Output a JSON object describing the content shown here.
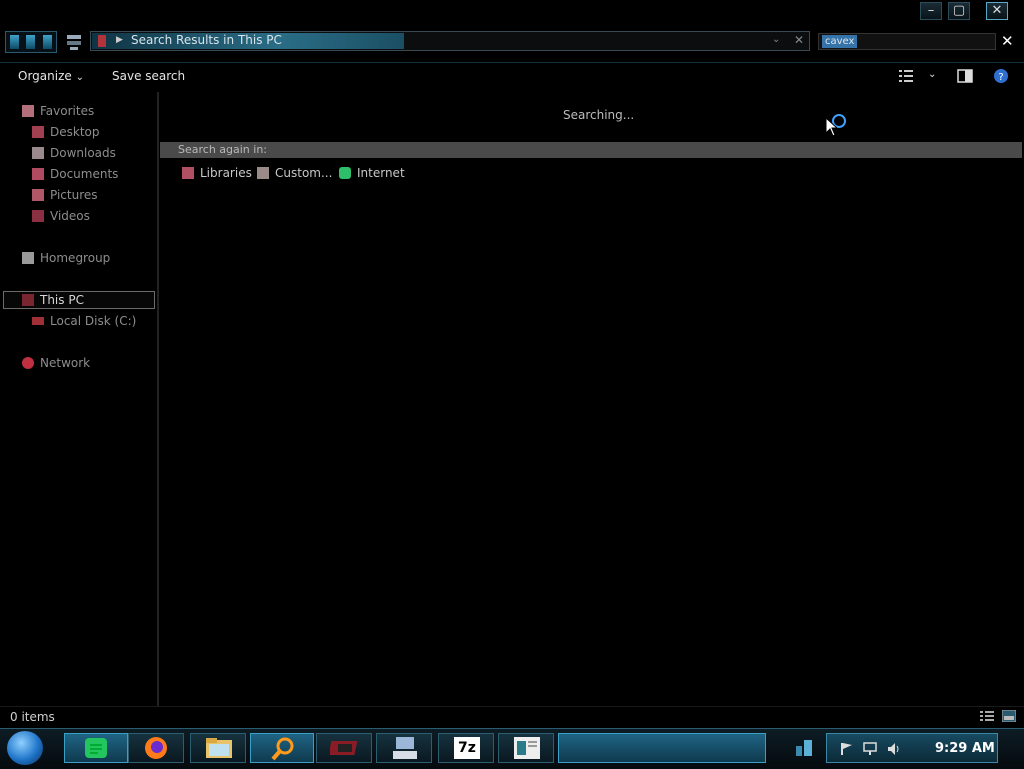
{
  "window": {
    "address": "Search Results in This PC",
    "search_query": "cavex"
  },
  "toolbar": {
    "organize_label": "Organize",
    "save_search_label": "Save search"
  },
  "nav": {
    "favorites": "Favorites",
    "desktop": "Desktop",
    "downloads": "Downloads",
    "documents": "Documents",
    "pictures": "Pictures",
    "videos": "Videos",
    "homegroup": "Homegroup",
    "this_pc": "This PC",
    "local_disk": "Local Disk (C:)",
    "network": "Network"
  },
  "content": {
    "searching": "Searching...",
    "search_again_label": "Search again in:",
    "search_again_items": [
      "Libraries",
      "Custom...",
      "Internet"
    ]
  },
  "status": {
    "items": "0 items"
  },
  "taskbar": {
    "clock": "9:29 AM",
    "sevenzip_label": "7z"
  },
  "colors": {
    "accent": "#2a6d86",
    "selection": "#3573a8",
    "busy_ring": "#3ea0ff"
  }
}
